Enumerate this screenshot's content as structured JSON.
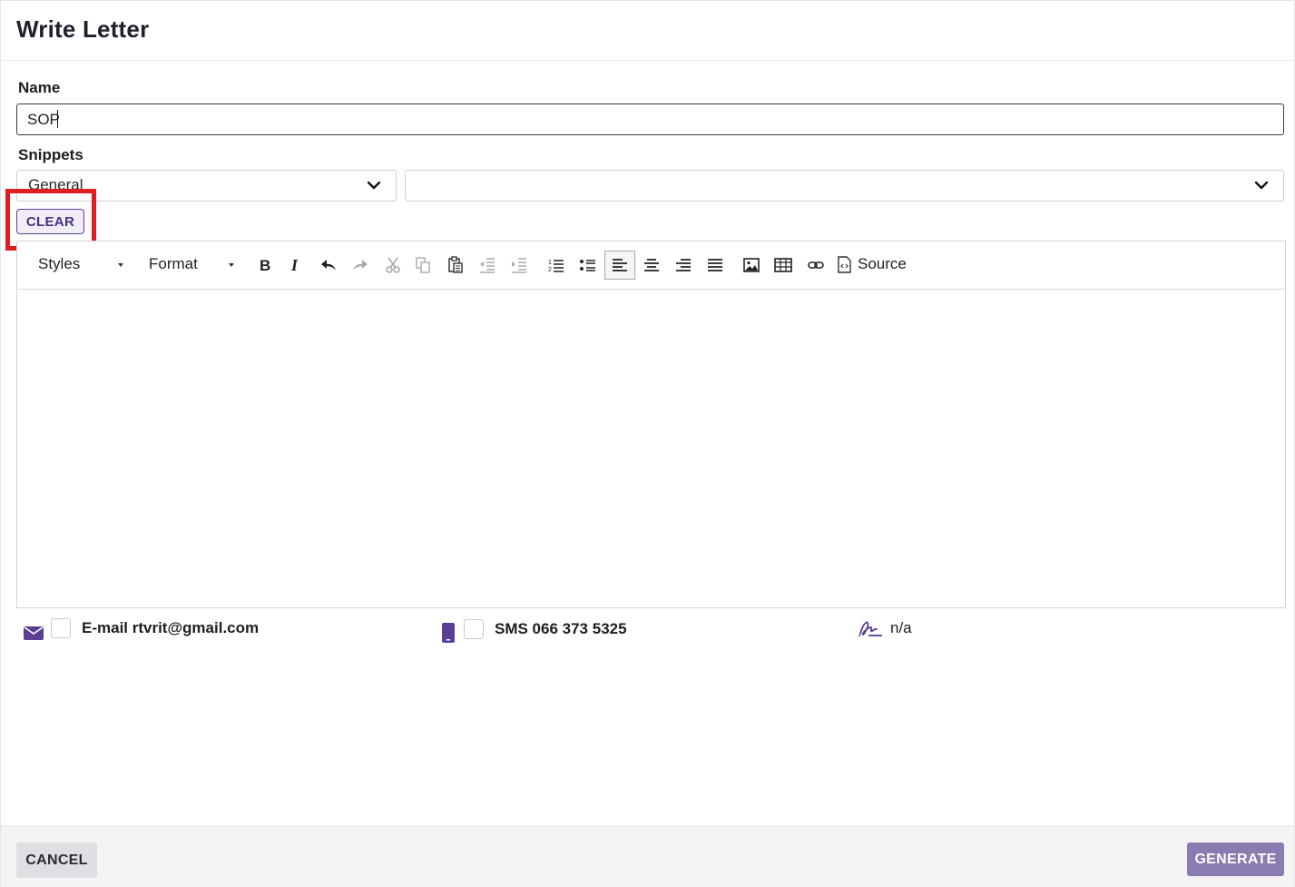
{
  "dialog": {
    "title": "Write Letter"
  },
  "name_field": {
    "label": "Name",
    "value": "SOP"
  },
  "snippets": {
    "label": "Snippets",
    "category_value": "General",
    "snippet_value": "",
    "clear_label": "CLEAR"
  },
  "toolbar": {
    "styles_label": "Styles",
    "format_label": "Format",
    "source_label": "Source",
    "icons": [
      "bold-icon",
      "italic-icon",
      "undo-icon",
      "redo-icon",
      "cut-icon",
      "copy-icon",
      "paste-icon",
      "outdent-icon",
      "indent-icon",
      "numbered-list-icon",
      "bulleted-list-icon",
      "align-left-icon",
      "align-center-icon",
      "align-right-icon",
      "justify-icon",
      "image-icon",
      "table-icon",
      "link-icon",
      "source-icon"
    ]
  },
  "contacts": {
    "email_label": "E-mail rtvrit@gmail.com",
    "sms_label": "SMS 066 373 5325",
    "signature_label": "n/a"
  },
  "footer": {
    "cancel_label": "CANCEL",
    "generate_label": "GENERATE"
  },
  "colors": {
    "accent": "#5b3f94",
    "highlight": "#e11d22",
    "generate_bg": "#8a7bb0",
    "cancel_bg": "#dedfe3"
  }
}
